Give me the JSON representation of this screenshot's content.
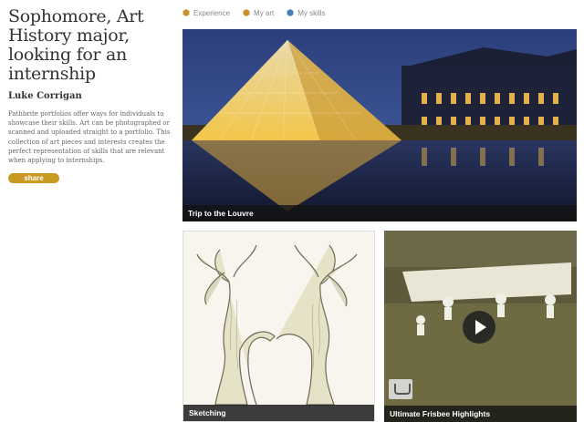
{
  "profile": {
    "headline": "Sophomore, Art History major, looking for an internship",
    "author": "Luke Corrigan",
    "description": "Pathbrite portfolios offer ways for individuals to showcase their skills. Art can be photographed or scanned and uploaded straight to a portfolio. This collection of art pieces and interests creates the perfect representation of skills that are relevant when applying to internships.",
    "share_label": "share"
  },
  "nav": {
    "items": [
      {
        "label": "Experience",
        "color": "#c8922a"
      },
      {
        "label": "My art",
        "color": "#c8922a"
      },
      {
        "label": "My skills",
        "color": "#4a7fb5"
      }
    ]
  },
  "tiles": [
    {
      "caption": "Trip to the Louvre",
      "kind": "image"
    },
    {
      "caption": "Sketching",
      "kind": "image"
    },
    {
      "caption": "Ultimate Frisbee Highlights",
      "kind": "video"
    }
  ],
  "colors": {
    "accent": "#c99a22",
    "caption_bg": "#141414"
  }
}
